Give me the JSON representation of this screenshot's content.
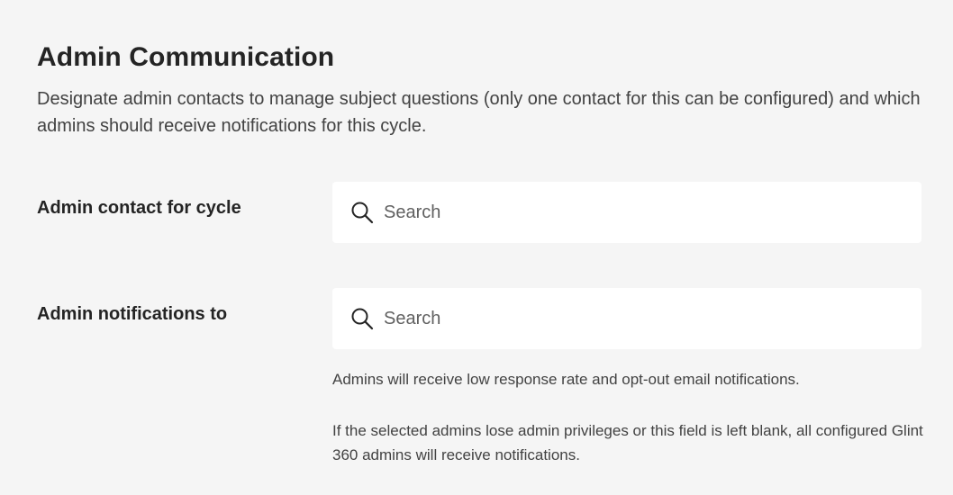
{
  "section": {
    "title": "Admin Communication",
    "description": "Designate admin contacts to manage subject questions (only one contact for this can be configured) and which admins should receive notifications for this cycle."
  },
  "admin_contact": {
    "label": "Admin contact for cycle",
    "search_placeholder": "Search",
    "search_value": "",
    "icon": "search-icon"
  },
  "admin_notifications": {
    "label": "Admin notifications to",
    "search_placeholder": "Search",
    "search_value": "",
    "icon": "search-icon",
    "help_text_1": "Admins will receive low response rate and opt-out email notifications.",
    "help_text_2": "If the selected admins lose admin privileges or this field is left blank, all configured Glint 360 admins will receive notifications."
  },
  "colors": {
    "page_background": "#f5f5f5",
    "input_background": "#ffffff",
    "text_primary": "#242424",
    "text_secondary": "#424242",
    "placeholder": "#616161"
  }
}
